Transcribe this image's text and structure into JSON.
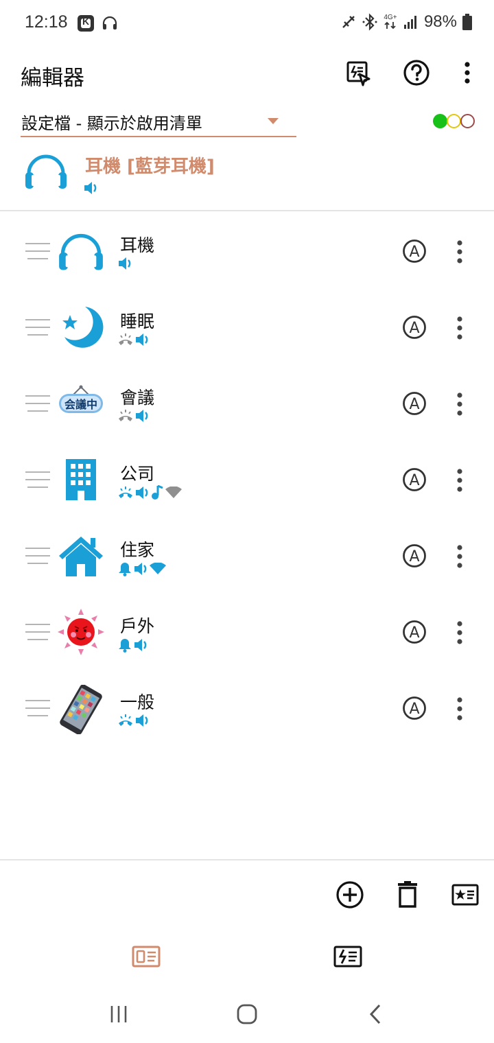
{
  "status_bar": {
    "time": "12:18",
    "k_label": "K",
    "network": "4G+",
    "battery": "98%"
  },
  "app_bar": {
    "title": "編輯器"
  },
  "selector": {
    "value": "設定檔 - 顯示於啟用清單"
  },
  "colors": {
    "accent": "#d08a6c",
    "icon_blue": "#1a9fd6",
    "status_grey": "#8f8f8f",
    "dot_green": "#17c117",
    "dot_yellow": "#e6c800",
    "dot_red": "#a04848"
  },
  "active_profile": {
    "title": "耳機 [藍芽耳機]",
    "icon": "headphones-icon",
    "status_icons": [
      "volume-icon"
    ]
  },
  "profiles": [
    {
      "name": "耳機",
      "icon": "headphones-icon",
      "status_icons": [
        "volume-icon"
      ]
    },
    {
      "name": "睡眠",
      "icon": "moon-star-icon",
      "status_icons": [
        "ring-muted-icon",
        "volume-icon"
      ]
    },
    {
      "name": "會議",
      "icon": "meeting-sign-icon",
      "status_icons": [
        "ring-muted-icon",
        "volume-icon"
      ]
    },
    {
      "name": "公司",
      "icon": "office-building-icon",
      "status_icons": [
        "ring-vibrate-icon",
        "volume-icon",
        "music-note-icon",
        "wifi-off-icon"
      ]
    },
    {
      "name": "住家",
      "icon": "house-icon",
      "status_icons": [
        "bell-icon",
        "volume-icon",
        "wifi-icon"
      ]
    },
    {
      "name": "戶外",
      "icon": "sun-icon",
      "status_icons": [
        "bell-icon",
        "volume-icon"
      ]
    },
    {
      "name": "一般",
      "icon": "smartphone-icon",
      "status_icons": [
        "ring-vibrate-icon",
        "volume-icon"
      ]
    }
  ],
  "meeting_sign_text": "会議中",
  "auto_label": "A",
  "toolbar": {
    "items": [
      "add-circle-icon",
      "trash-icon",
      "profile-star-icon"
    ]
  },
  "bottom_tabs": {
    "items": [
      "profiles-tab-icon",
      "events-tab-icon"
    ]
  },
  "nav": {
    "items": [
      "recent-apps-icon",
      "home-icon",
      "back-icon"
    ]
  }
}
